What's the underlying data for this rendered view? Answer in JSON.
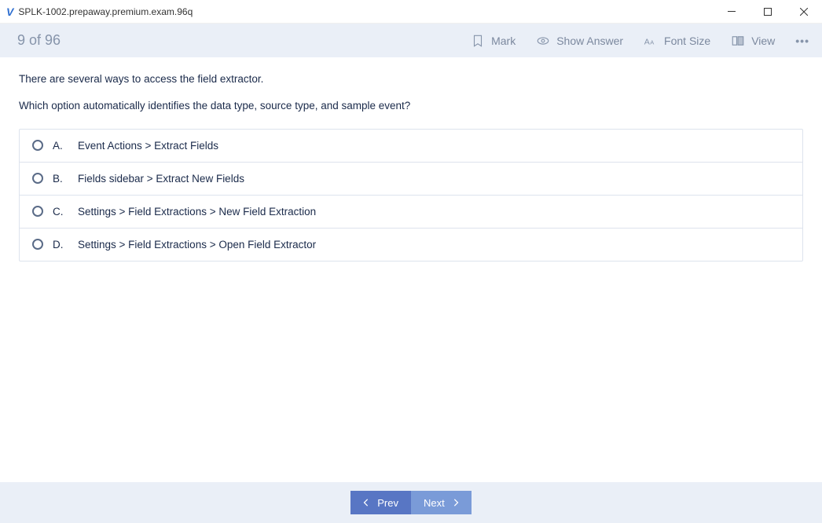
{
  "window": {
    "title": "SPLK-1002.prepaway.premium.exam.96q"
  },
  "toolbar": {
    "counter": "9 of 96",
    "mark": "Mark",
    "show_answer": "Show Answer",
    "font_size": "Font Size",
    "view": "View"
  },
  "question": {
    "line1": "There are several ways to access the field extractor.",
    "line2": "Which option automatically identifies the data type, source type, and sample event?"
  },
  "options": [
    {
      "letter": "A.",
      "text": "Event Actions > Extract Fields"
    },
    {
      "letter": "B.",
      "text": "Fields sidebar > Extract New Fields"
    },
    {
      "letter": "C.",
      "text": "Settings > Field Extractions > New Field Extraction"
    },
    {
      "letter": "D.",
      "text": "Settings > Field Extractions > Open Field Extractor"
    }
  ],
  "nav": {
    "prev": "Prev",
    "next": "Next"
  }
}
